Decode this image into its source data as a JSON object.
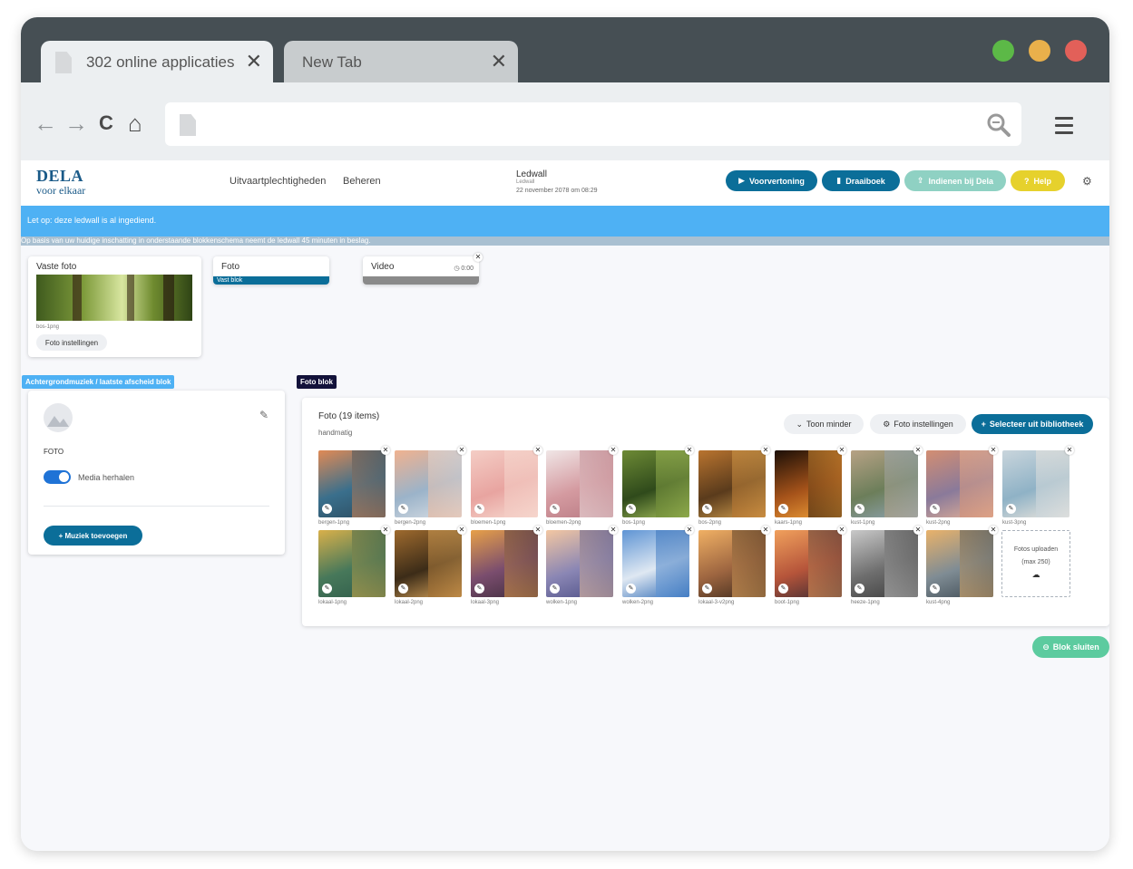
{
  "browser": {
    "tabs": [
      {
        "label": "302 online applicaties",
        "close": "✕"
      },
      {
        "label": "New Tab",
        "close": "✕"
      }
    ],
    "window_dots": [
      "#5cb947",
      "#e9b04b",
      "#e26059"
    ],
    "nav": {
      "back": "←",
      "forward": "→",
      "reload": "C",
      "home": "⌂"
    }
  },
  "header": {
    "logo_top": "DELA",
    "logo_bottom": "voor elkaar",
    "nav": [
      "Uitvaartplechtigheden",
      "Beheren"
    ],
    "ledwall_title": "Ledwall",
    "ledwall_sub": "Ledwall",
    "ledwall_date": "22 november 2078 om 08:29",
    "buttons": [
      {
        "label": "Voorvertoning",
        "icon": "▶",
        "color": "#0b6e99"
      },
      {
        "label": "Draaiboek",
        "icon": "▮",
        "color": "#0b6e99"
      },
      {
        "label": "Indienen bij Dela",
        "icon": "⇪",
        "color": "#8fd1c3"
      },
      {
        "label": "Help",
        "icon": "?",
        "color": "#e6d12c"
      }
    ],
    "settings_icon": "⚙"
  },
  "banner": {
    "text": "Let op: deze ledwall is al ingediend.",
    "info": "Op basis van uw huidige inschatting in onderstaande blokkenschema neemt de ledwall 45 minuten in beslag."
  },
  "blocks": {
    "vaste_foto": {
      "title": "Vaste foto",
      "caption": "bos-1png",
      "button": "Foto instellingen"
    },
    "foto": {
      "title": "Foto",
      "tag": "Vast blok"
    },
    "video": {
      "title": "Video",
      "time": "0:00",
      "close": "✕"
    }
  },
  "music_block": {
    "tag": "Achtergrondmuziek / laatste afscheid blok",
    "type": "FOTO",
    "toggle_label": "Media herhalen",
    "toggle_on": true,
    "button": "+ Muziek toevoegen",
    "edit_icon": "✎"
  },
  "foto_block": {
    "tag": "Foto blok",
    "title": "Foto (19 items)",
    "subtitle": "handmatig",
    "btn_less": "Toon minder",
    "btn_settings": "Foto instellingen",
    "btn_select": "Selecteer uit bibliotheek",
    "upload_text": "Fotos uploaden",
    "upload_max": "(max 250)",
    "photos": [
      {
        "name": "bergen-1png",
        "colors": [
          "#e08a55",
          "#3a6f8c",
          "#2c4b5e"
        ]
      },
      {
        "name": "bergen-2png",
        "colors": [
          "#f0b28f",
          "#9bb3c9",
          "#d9dee4"
        ]
      },
      {
        "name": "bloemen-1png",
        "colors": [
          "#f4cdc5",
          "#e8a4a0",
          "#f7dcd2"
        ]
      },
      {
        "name": "bloemen-2png",
        "colors": [
          "#f0e6e6",
          "#d49aa0",
          "#b87a83"
        ]
      },
      {
        "name": "bos-1png",
        "colors": [
          "#6d8a35",
          "#2f4a1b",
          "#a9c35d"
        ]
      },
      {
        "name": "bos-2png",
        "colors": [
          "#b9742f",
          "#5a3b1c",
          "#d4a04e"
        ]
      },
      {
        "name": "kaars-1png",
        "colors": [
          "#1c0f07",
          "#a6531a",
          "#f2a33a"
        ]
      },
      {
        "name": "kust-1png",
        "colors": [
          "#b7a285",
          "#6c7e5a",
          "#8fa4b4"
        ]
      },
      {
        "name": "kust-2png",
        "colors": [
          "#d38e72",
          "#8a7a9a",
          "#e6b296"
        ]
      },
      {
        "name": "kust-3png",
        "colors": [
          "#c9d5dc",
          "#8fb2c6",
          "#eee6dd"
        ]
      },
      {
        "name": "lokaal-1png",
        "colors": [
          "#d9b04a",
          "#47785a",
          "#2f5c4a"
        ]
      },
      {
        "name": "lokaal-2png",
        "colors": [
          "#9e6a2e",
          "#3c2c18",
          "#d8a45a"
        ]
      },
      {
        "name": "lokaal-3png",
        "colors": [
          "#e7a048",
          "#7a4d6e",
          "#3f2c3c"
        ]
      },
      {
        "name": "wolken-1png",
        "colors": [
          "#f3c7a2",
          "#8a86b4",
          "#4d4f86"
        ]
      },
      {
        "name": "wolken-2png",
        "colors": [
          "#5e94d4",
          "#dfe8f2",
          "#2f6bb6"
        ]
      },
      {
        "name": "lokaal-3-v2png",
        "colors": [
          "#f0b064",
          "#9d6540",
          "#3d2a1c"
        ]
      },
      {
        "name": "boot-1png",
        "colors": [
          "#f0a05c",
          "#b5543a",
          "#3b2b33"
        ]
      },
      {
        "name": "heeze-1png",
        "colors": [
          "#c9c9c9",
          "#6e6e6e",
          "#3d3d3d"
        ]
      },
      {
        "name": "kust-4png",
        "colors": [
          "#e9b26a",
          "#7f8c94",
          "#3f4b54"
        ]
      }
    ]
  },
  "close_block": {
    "label": "Blok sluiten",
    "icon": "⊖"
  }
}
